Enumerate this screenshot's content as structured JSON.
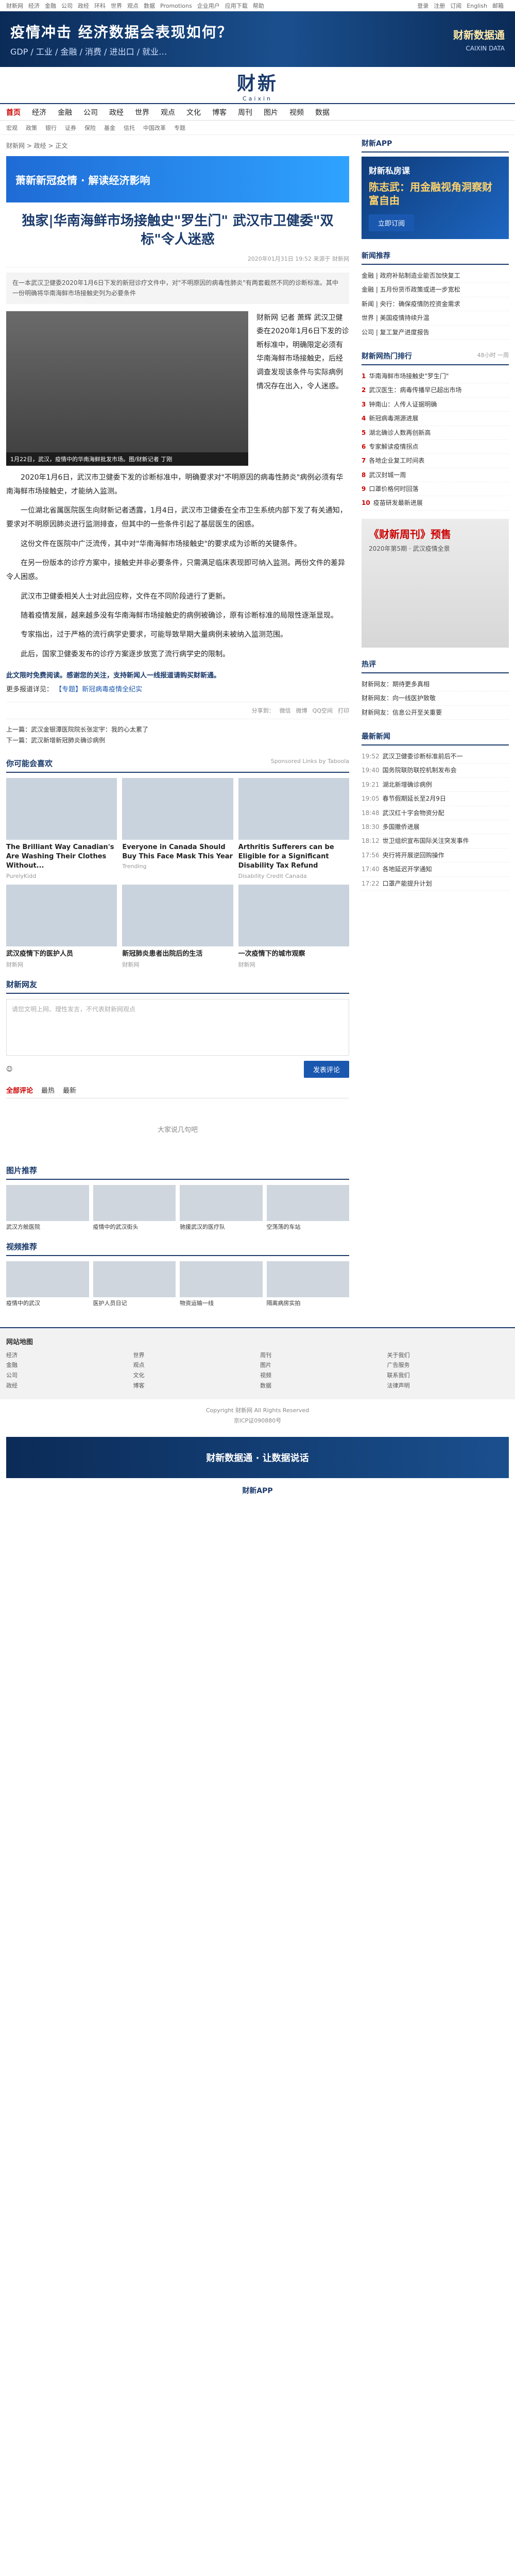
{
  "topbar": {
    "left": [
      "财新网",
      "经济",
      "金融",
      "公司",
      "政经",
      "环科",
      "世界",
      "观点",
      "数据",
      "Promotions",
      "企业用户",
      "应用下载",
      "帮助"
    ],
    "right": [
      "登录",
      "注册",
      "订阅",
      "English",
      "邮箱"
    ]
  },
  "banner": {
    "title": "疫情冲击 经济数据会表现如何？",
    "subtitle": "GDP / 工业 / 金融 / 消费 / 进出口 / 就业…",
    "right_title": "财新数据通",
    "right_sub": "CAIXIN DATA"
  },
  "logo": {
    "cn": "财新",
    "en": "Caixin"
  },
  "nav": {
    "items": [
      "首页",
      "经济",
      "金融",
      "公司",
      "政经",
      "世界",
      "观点",
      "文化",
      "博客",
      "周刊",
      "图片",
      "视频",
      "数据"
    ]
  },
  "subnav": {
    "items": [
      "宏观",
      "政策",
      "银行",
      "证券",
      "保险",
      "基金",
      "信托",
      "中国改革",
      "专题"
    ]
  },
  "article": {
    "crumb": "财新网 > 政经 > 正文",
    "ad_text": "萧新新冠疫情 · 解读经济影响",
    "title": "独家|华南海鲜市场接触史\"罗生门\" 武汉市卫健委\"双标\"令人迷惑",
    "meta": "2020年01月31日 19:52  来源于 财新网",
    "summary": "在一本武汉卫健委2020年1月6日下发的新冠诊疗文件中，对\"不明原因的病毒性肺炎\"有两套截然不同的诊断标准。其中一份明确将华南海鲜市场接触史列为必要条件",
    "figure_caption": "1月22日，武汉，疫情中的华南海鲜批发市场。图/财新记者 丁刚",
    "intro": "财新网 记者 萧辉 武汉卫健委在2020年1月6日下发的诊断标准中，明确限定必须有华南海鲜市场接触史，后经调查发现该条件与实际病例情况存在出入，令人迷惑。",
    "paragraphs": [
      "2020年1月6日，武汉市卫健委下发的诊断标准中，明确要求对\"不明原因的病毒性肺炎\"病例必须有华南海鲜市场接触史，才能纳入监测。",
      "一位湖北省属医院医生向财新记者透露，1月4日，武汉市卫健委在全市卫生系统内部下发了有关通知，要求对不明原因肺炎进行监测排查，但其中的一些条件引起了基层医生的困惑。",
      "这份文件在医院中广泛流传，其中对\"华南海鲜市场接触史\"的要求成为诊断的关键条件。",
      "在另一份版本的诊疗方案中，接触史并非必要条件，只需满足临床表现即可纳入监测。两份文件的差异令人困惑。",
      "武汉市卫健委相关人士对此回应称，文件在不同阶段进行了更新。",
      "随着疫情发展，越来越多没有华南海鲜市场接触史的病例被确诊，原有诊断标准的局限性逐渐显现。",
      "专家指出，过于严格的流行病学史要求，可能导致早期大量病例未被纳入监测范围。",
      "此后，国家卫健委发布的诊疗方案逐步放宽了流行病学史的限制。"
    ],
    "notice": "此文限时免费阅读。感谢您的关注，支持新闻人一线报道请购买财新通。",
    "more_label": "更多报道详见：",
    "more_link": "【专题】新冠病毒疫情全纪实"
  },
  "share": [
    "分享到：",
    "微信",
    "微博",
    "QQ空间",
    "打印"
  ],
  "prevnext": [
    "上一篇：武汉金银潭医院院长张定宇：我的心太累了",
    "下一篇：武汉新增新冠肺炎确诊病例"
  ],
  "recommend": {
    "title": "你可能会喜欢",
    "sub": "Sponsored Links by Taboola",
    "cards": [
      {
        "cap": "The Brilliant Way Canadian's Are Washing Their Clothes Without...",
        "src": "PurelyKidd"
      },
      {
        "cap": "Everyone in Canada Should Buy This Face Mask This Year",
        "src": "Trending"
      },
      {
        "cap": "Arthritis Sufferers can be Eligible for a Significant Disability Tax Refund",
        "src": "Disability Credit Canada"
      },
      {
        "cap": "武汉疫情下的医护人员",
        "src": "财新网"
      },
      {
        "cap": "新冠肺炎患者出院后的生活",
        "src": "财新网"
      },
      {
        "cap": "一次疫情下的城市观察",
        "src": "财新网"
      }
    ]
  },
  "comment": {
    "title": "财新网友",
    "placeholder": "请您文明上网、理性发言，不代表财新网观点",
    "submit": "发表评论",
    "tabs": [
      "全部评论",
      "最热",
      "最新"
    ],
    "empty": "大家说几句吧"
  },
  "photo_strip": {
    "title": "图片推荐",
    "items": [
      "武汉方舱医院",
      "疫情中的武汉街头",
      "驰援武汉的医疗队",
      "空荡荡的车站"
    ]
  },
  "video_strip": {
    "title": "视频推荐",
    "items": [
      "疫情中的武汉",
      "医护人员日记",
      "物资运输一线",
      "隔离病房实拍"
    ]
  },
  "sidebar": {
    "app_title": "财新APP",
    "ad_title": "财新私房课",
    "ad_sub": "陈志武：用金融视角洞察财富自由",
    "ad_btn": "立即订阅",
    "focus_title": "新闻推荐",
    "focus": [
      "金融 | 政府补贴制造业能否加快复工",
      "金融 | 五月份货币政策或进一步宽松",
      "新闻 | 央行：确保疫情防控资金需求",
      "世界 | 美国疫情持续升温",
      "公司 | 复工复产进度报告"
    ],
    "hot_title": "财新网热门排行",
    "hot_tabs": [
      "48小时",
      "一周"
    ],
    "hot": [
      "华南海鲜市场接触史\"罗生门\"",
      "武汉医生：病毒传播早已超出市场",
      "钟南山：人传人证据明确",
      "新冠病毒溯源进展",
      "湖北确诊人数再创新高",
      "专家解读疫情拐点",
      "各地企业复工时间表",
      "武汉封城一周",
      "口罩价格何时回落",
      "疫苗研发最新进展"
    ],
    "promo_title": "《财新周刊》预售",
    "promo_sub": "2020年第5期 · 武汉疫情全景",
    "comm_title": "热评",
    "comm": [
      "财新网友：期待更多真相",
      "财新网友：向一线医护致敬",
      "财新网友：信息公开至关重要"
    ],
    "news_title": "最新新闻",
    "news": [
      {
        "t": "19:52",
        "s": "武汉卫健委诊断标准前后不一"
      },
      {
        "t": "19:40",
        "s": "国务院联防联控机制发布会"
      },
      {
        "t": "19:21",
        "s": "湖北新增确诊病例"
      },
      {
        "t": "19:05",
        "s": "春节假期延长至2月9日"
      },
      {
        "t": "18:48",
        "s": "武汉红十字会物资分配"
      },
      {
        "t": "18:30",
        "s": "多国撤侨进展"
      },
      {
        "t": "18:12",
        "s": "世卫组织宣布国际关注突发事件"
      },
      {
        "t": "17:56",
        "s": "央行将开展逆回购操作"
      },
      {
        "t": "17:40",
        "s": "各地延迟开学通知"
      },
      {
        "t": "17:22",
        "s": "口罩产能提升计划"
      }
    ]
  },
  "footer": {
    "title": "网站地图",
    "cols": [
      [
        "经济",
        "金融",
        "公司",
        "政经"
      ],
      [
        "世界",
        "观点",
        "文化",
        "博客"
      ],
      [
        "周刊",
        "图片",
        "视频",
        "数据"
      ],
      [
        "关于我们",
        "广告服务",
        "联系我们",
        "法律声明"
      ]
    ],
    "copy1": "Copyright 财新网 All Rights Reserved",
    "copy2": "京ICP证090880号"
  },
  "bottom_ad": "财新数据通 · 让数据说话",
  "download": "财新APP"
}
